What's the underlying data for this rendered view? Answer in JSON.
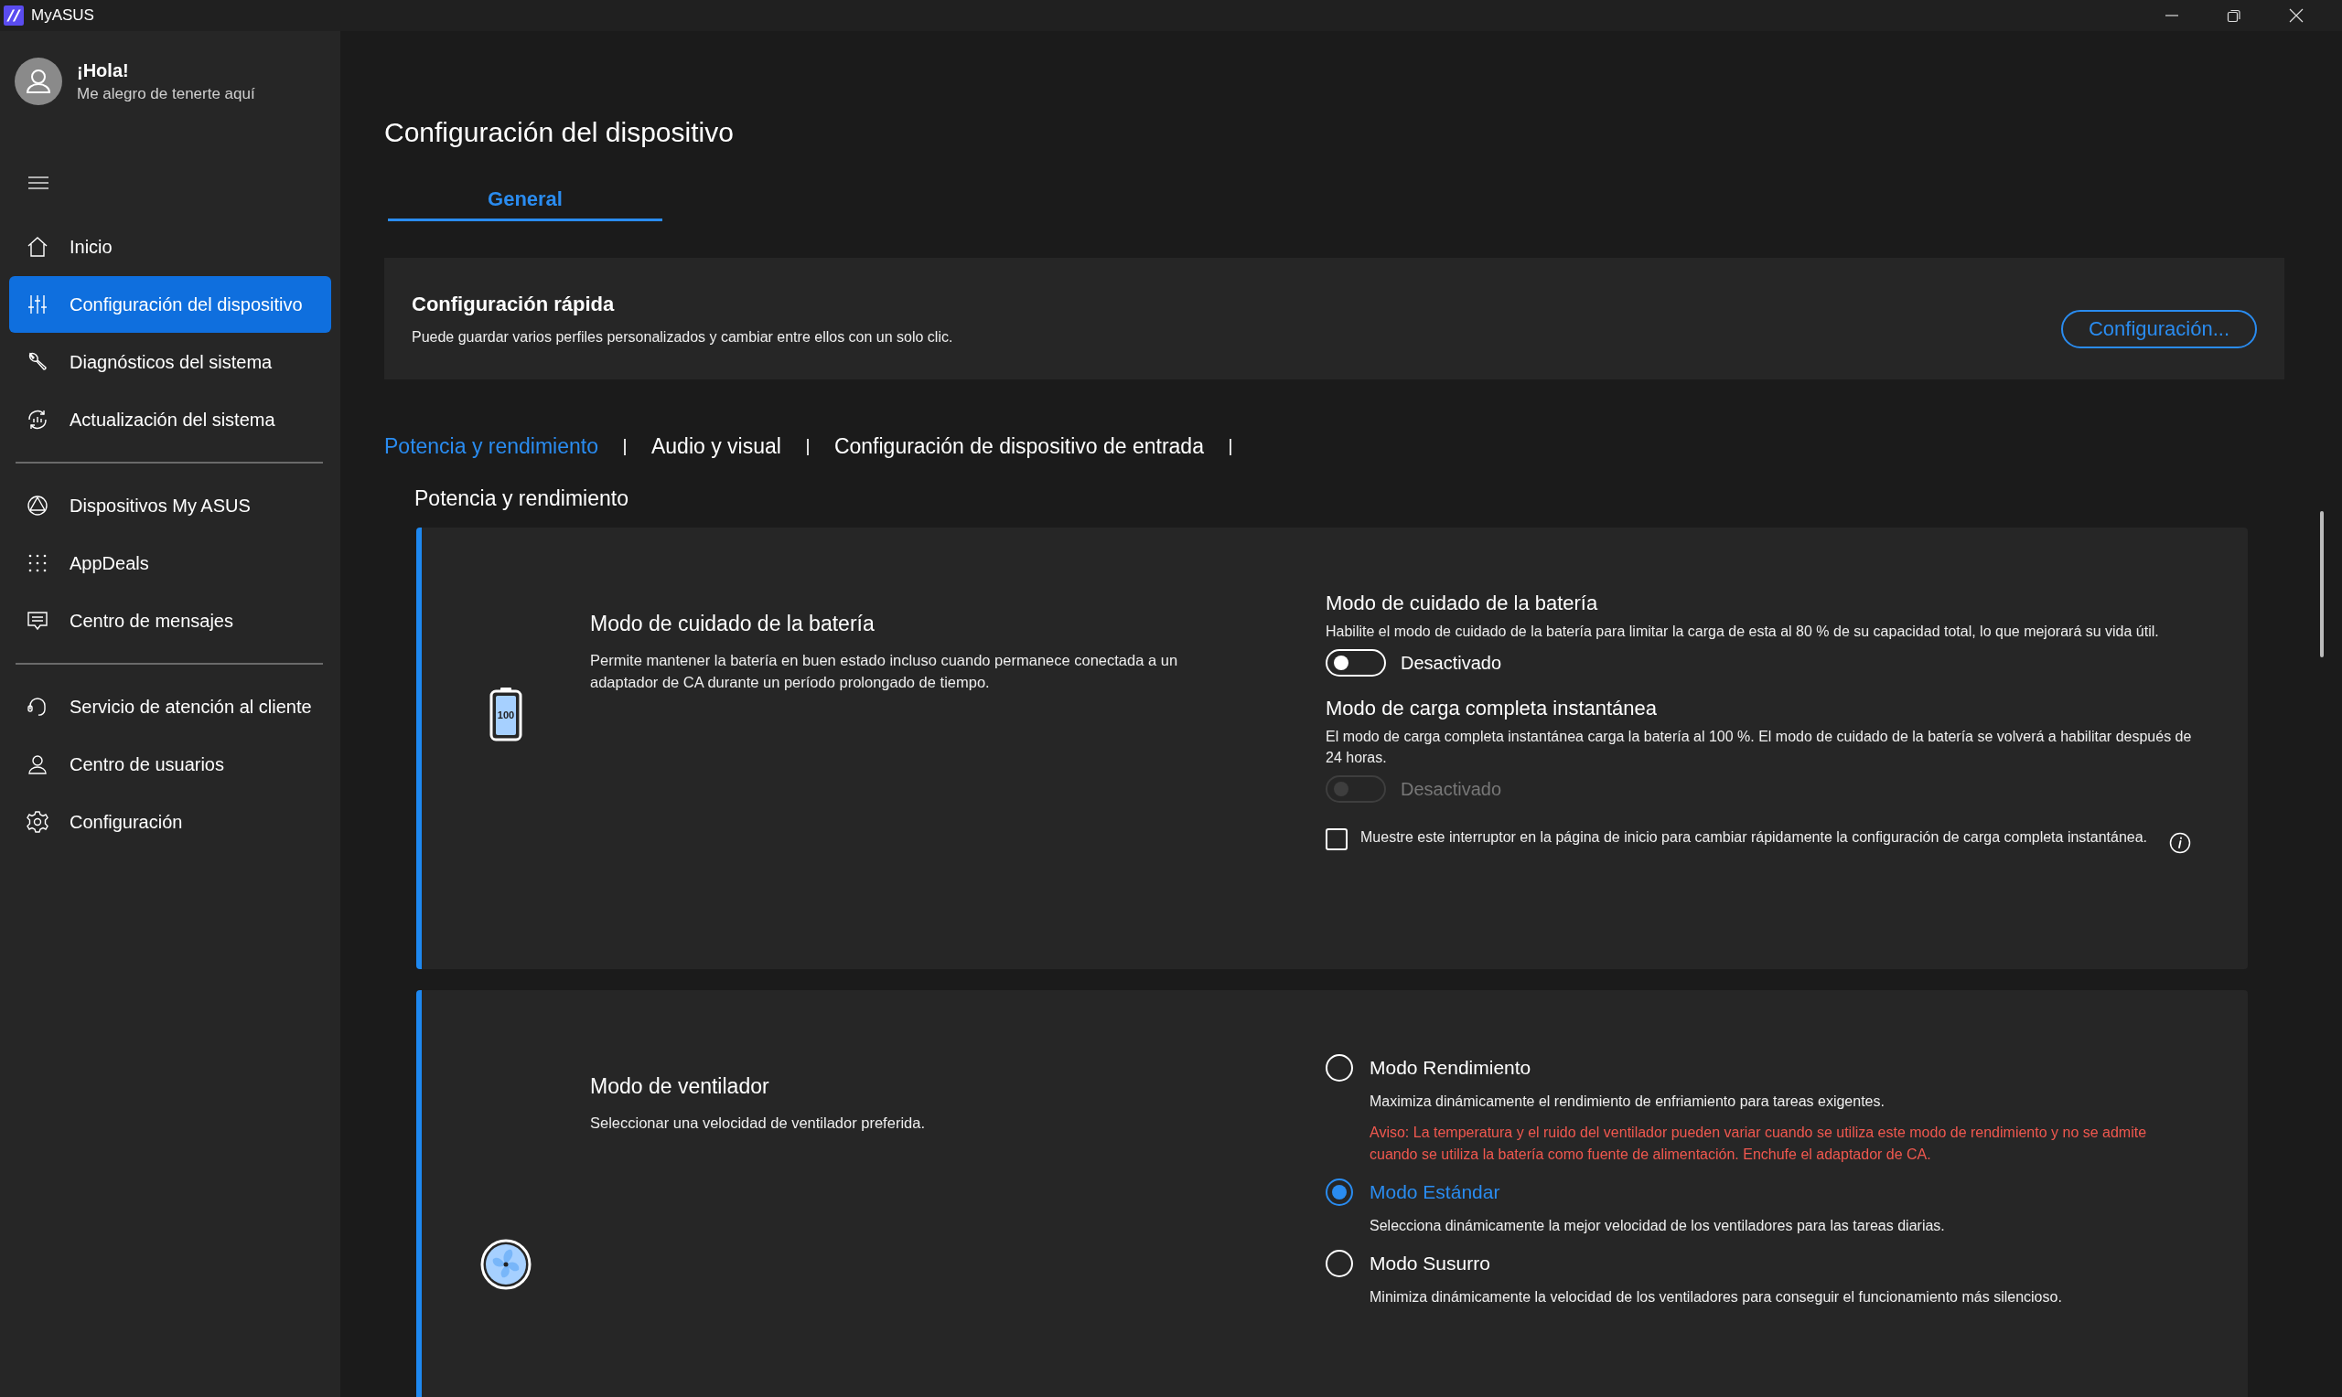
{
  "window": {
    "title": "MyASUS"
  },
  "user": {
    "greeting": "¡Hola!",
    "subtitle": "Me alegro de tenerte aquí"
  },
  "sidebar": {
    "groups": [
      {
        "items": [
          {
            "label": "Inicio",
            "selected": false
          },
          {
            "label": "Configuración del dispositivo",
            "selected": true
          },
          {
            "label": "Diagnósticos del sistema",
            "selected": false
          },
          {
            "label": "Actualización del sistema",
            "selected": false
          }
        ]
      },
      {
        "items": [
          {
            "label": "Dispositivos My ASUS",
            "selected": false
          },
          {
            "label": "AppDeals",
            "selected": false
          },
          {
            "label": "Centro de mensajes",
            "selected": false
          }
        ]
      },
      {
        "items": [
          {
            "label": "Servicio de atención al cliente",
            "selected": false
          },
          {
            "label": "Centro de usuarios",
            "selected": false
          },
          {
            "label": "Configuración",
            "selected": false
          }
        ]
      }
    ]
  },
  "page": {
    "title": "Configuración del dispositivo",
    "tabs": [
      {
        "label": "General",
        "selected": true
      }
    ],
    "quick_settings": {
      "title": "Configuración rápida",
      "description": "Puede guardar varios perfiles personalizados y cambiar entre ellos con un solo clic.",
      "button": "Configuración..."
    },
    "section_tabs": [
      {
        "label": "Potencia y rendimiento",
        "selected": true
      },
      {
        "label": "Audio y visual",
        "selected": false
      },
      {
        "label": "Configuración de dispositivo de entrada",
        "selected": false
      }
    ],
    "section_title": "Potencia y rendimiento",
    "cards": [
      {
        "title": "Modo de cuidado de la batería",
        "description": "Permite mantener la batería en buen estado incluso cuando permanece conectada a un adaptador de CA durante un período prolongado de tiempo.",
        "icon_text": "100",
        "settings": [
          {
            "kind": "toggle",
            "title": "Modo de cuidado de la batería",
            "description": "Habilite el modo de cuidado de la batería para limitar la carga de esta al 80 % de su capacidad total, lo que mejorará su vida útil.",
            "on": false,
            "disabled": false,
            "state_label": "Desactivado"
          },
          {
            "kind": "toggle",
            "title": "Modo de carga completa instantánea",
            "description": "El modo de carga completa instantánea carga la batería al 100 %. El modo de cuidado de la batería se volverá a habilitar después de 24 horas.",
            "on": false,
            "disabled": true,
            "state_label": "Desactivado"
          },
          {
            "kind": "checkbox",
            "label": "Muestre este interruptor en la página de inicio para cambiar rápidamente la configuración de carga completa instantánea.",
            "checked": false
          }
        ]
      },
      {
        "title": "Modo de ventilador",
        "description": "Seleccionar una velocidad de ventilador preferida.",
        "settings": [
          {
            "kind": "radio",
            "label": "Modo Rendimiento",
            "description": "Maximiza dinámicamente el rendimiento de enfriamiento para tareas exigentes.",
            "warning": "Aviso: La temperatura y el ruido del ventilador pueden variar cuando se utiliza este modo de rendimiento y no se admite cuando se utiliza la batería como fuente de alimentación. Enchufe el adaptador de CA.",
            "selected": false
          },
          {
            "kind": "radio",
            "label": "Modo Estándar",
            "description": "Selecciona dinámicamente la mejor velocidad de los ventiladores para las tareas diarias.",
            "selected": true
          },
          {
            "kind": "radio",
            "label": "Modo Susurro",
            "description": "Minimiza dinámicamente la velocidad de los ventiladores para conseguir el funcionamiento más silencioso.",
            "selected": false
          }
        ]
      }
    ]
  }
}
